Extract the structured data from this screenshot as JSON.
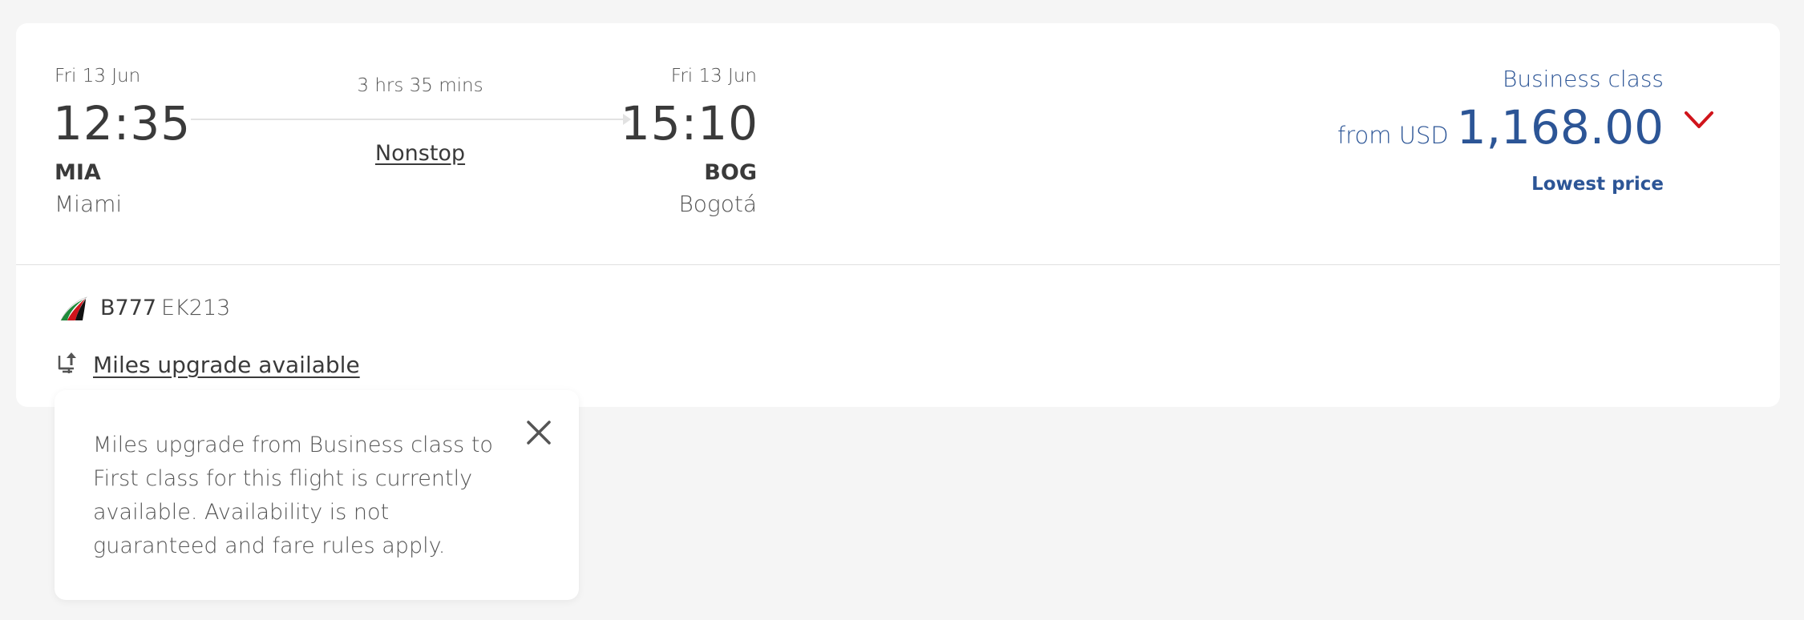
{
  "flight": {
    "departure": {
      "date": "Fri 13 Jun",
      "time": "12:35",
      "code": "MIA",
      "city": "Miami"
    },
    "arrival": {
      "date": "Fri 13 Jun",
      "time": "15:10",
      "code": "BOG",
      "city": "Bogotá"
    },
    "duration": "3 hrs 35 mins",
    "stops": "Nonstop"
  },
  "fare": {
    "cabin": "Business class",
    "price_prefix": "from USD",
    "price": "1,168.00",
    "badge": "Lowest price"
  },
  "details": {
    "aircraft": "B777",
    "flight_number": "EK213",
    "upgrade_link": "Miles upgrade available"
  },
  "tooltip": {
    "text": "Miles upgrade from Business class to First class for this flight is currently available. Availability is not guaranteed and fare rules apply."
  },
  "icons": {
    "airline": "emirates-logo-icon",
    "upgrade": "seat-upgrade-icon",
    "expand": "chevron-down-icon",
    "close": "close-icon",
    "route": "arrow-right-icon"
  },
  "colors": {
    "accent_blue": "#2c5596",
    "chevron_red": "#d0141b",
    "background": "#f5f5f5",
    "card": "#ffffff"
  }
}
